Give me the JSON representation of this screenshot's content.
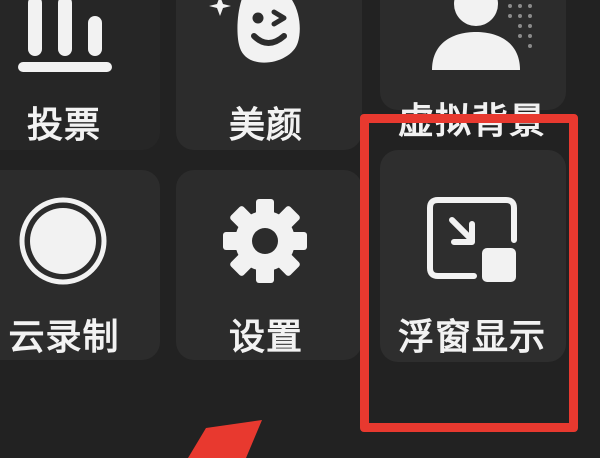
{
  "menu": {
    "items": [
      {
        "id": "vote",
        "label": "投票",
        "icon": "bar-chart-icon"
      },
      {
        "id": "beauty",
        "label": "美颜",
        "icon": "smiley-face-icon"
      },
      {
        "id": "virtual-background",
        "label": "虚拟背景",
        "icon": "person-silhouette-icon"
      },
      {
        "id": "cloud-record",
        "label": "云录制",
        "icon": "record-circle-icon"
      },
      {
        "id": "settings",
        "label": "设置",
        "icon": "gear-icon"
      },
      {
        "id": "floating-window",
        "label": "浮窗显示",
        "icon": "picture-in-picture-icon"
      }
    ]
  },
  "colors": {
    "background": "#222222",
    "tile": "#2c2c2c",
    "text": "#f2f2f2",
    "highlight": "#e8392f"
  }
}
